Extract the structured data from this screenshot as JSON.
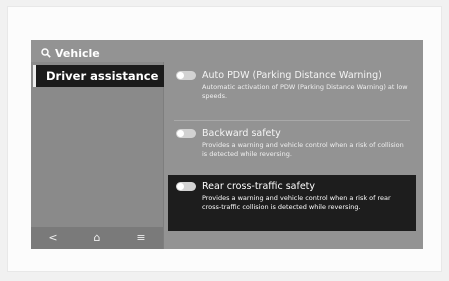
{
  "header": {
    "title": "Vehicle",
    "icon": "search-icon"
  },
  "sidebar": {
    "active_item": "Driver assistance"
  },
  "bottom_nav": {
    "back": "<",
    "home": "⌂",
    "menu": "≡"
  },
  "options": [
    {
      "title": "Auto PDW (Parking Distance Warning)",
      "description": "Automatic activation of PDW (Parking Distance Warning) at low speeds.",
      "enabled": false,
      "selected": false
    },
    {
      "title": "Backward safety",
      "description": "Provides a warning and vehicle control when a risk of collision is detected while reversing.",
      "enabled": false,
      "selected": false
    },
    {
      "title": "Rear cross-traffic safety",
      "description": "Provides a warning and vehicle control when a risk of rear cross-traffic collision is detected while reversing.",
      "enabled": false,
      "selected": true
    }
  ],
  "colors": {
    "screen_bg": "#939393",
    "selected_bg": "#1d1d1d",
    "toggle_off": "#d2d2d2"
  }
}
